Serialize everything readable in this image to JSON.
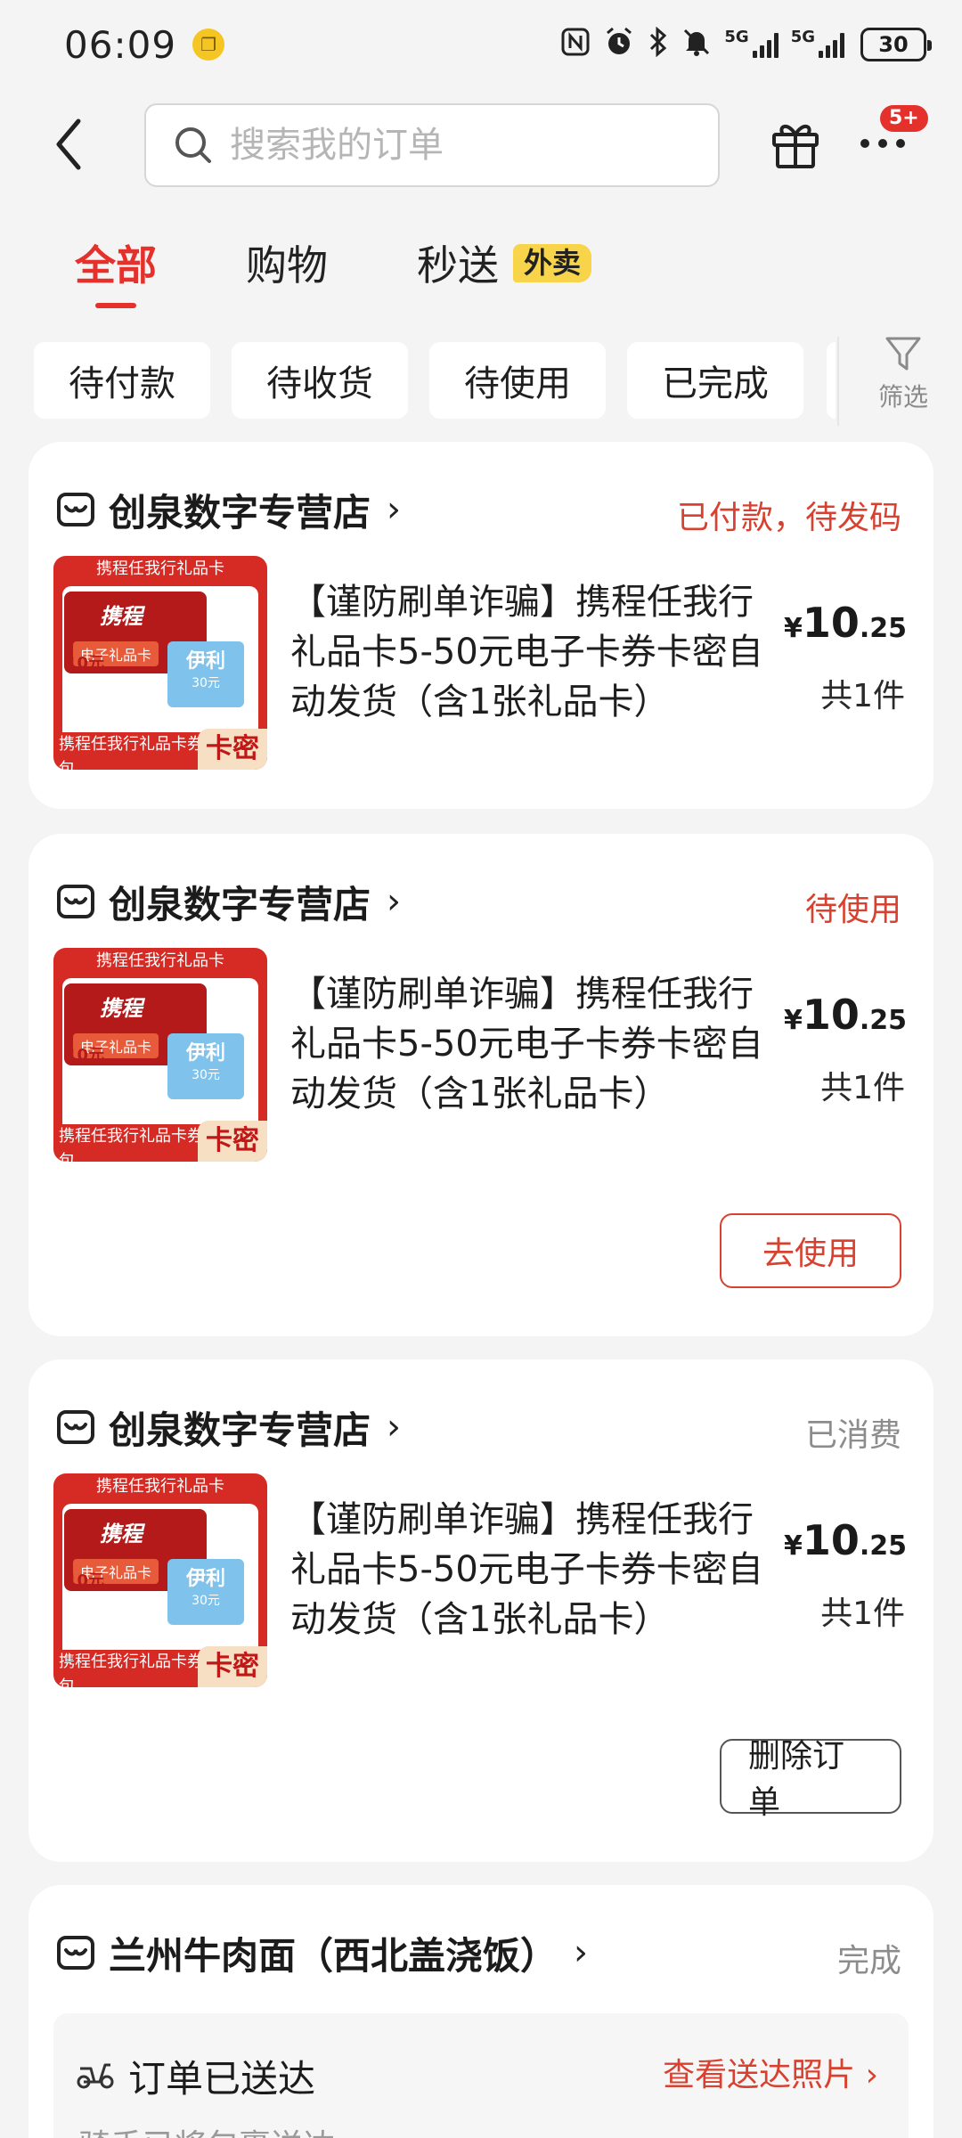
{
  "status_bar": {
    "time": "06:09",
    "network_1": "5G",
    "network_2": "5G",
    "battery": "30"
  },
  "header": {
    "search_placeholder": "搜索我的订单",
    "notification_badge": "5+"
  },
  "main_tabs": [
    {
      "label": "全部",
      "active": true
    },
    {
      "label": "购物",
      "active": false
    },
    {
      "label": "秒送",
      "active": false
    }
  ],
  "main_tab_badge": "外卖",
  "filters": {
    "chips": [
      "待付款",
      "待收货",
      "待使用",
      "已完成"
    ],
    "filter_label": "筛选"
  },
  "product_thumb": {
    "top_text": "携程任我行礼品卡",
    "brand": "携程",
    "card_label": "电子礼品卡",
    "amount": "10元",
    "blue_title": "伊利",
    "blue_sub": "30元",
    "bottom_text": "携程任我行礼品卡券包",
    "corner": "卡密"
  },
  "orders": [
    {
      "store": "创泉数字专营店",
      "status": "已付款，待发码",
      "title": "【谨防刷单诈骗】携程任我行礼品卡5-50元电子卡券卡密自动发货（含1张礼品卡）",
      "price_currency": "¥",
      "price_int": "10",
      "price_dec": ".25",
      "qty": "共1件"
    },
    {
      "store": "创泉数字专营店",
      "status": "待使用",
      "title": "【谨防刷单诈骗】携程任我行礼品卡5-50元电子卡券卡密自动发货（含1张礼品卡）",
      "price_currency": "¥",
      "price_int": "10",
      "price_dec": ".25",
      "qty": "共1件",
      "action": "去使用"
    },
    {
      "store": "创泉数字专营店",
      "status": "已消费",
      "title": "【谨防刷单诈骗】携程任我行礼品卡5-50元电子卡券卡密自动发货（含1张礼品卡）",
      "price_currency": "¥",
      "price_int": "10",
      "price_dec": ".25",
      "qty": "共1件",
      "action": "删除订单"
    },
    {
      "store": "兰州牛肉面（西北盖浇饭）",
      "status": "完成",
      "delivery_title": "订单已送达",
      "delivery_link": "查看送达照片",
      "delivery_sub": "骑手已将包裹送达"
    }
  ],
  "colors": {
    "accent_red": "#e5312b",
    "status_red": "#d8412f",
    "badge_yellow": "#f7d44a",
    "background": "#f4f4f5"
  }
}
